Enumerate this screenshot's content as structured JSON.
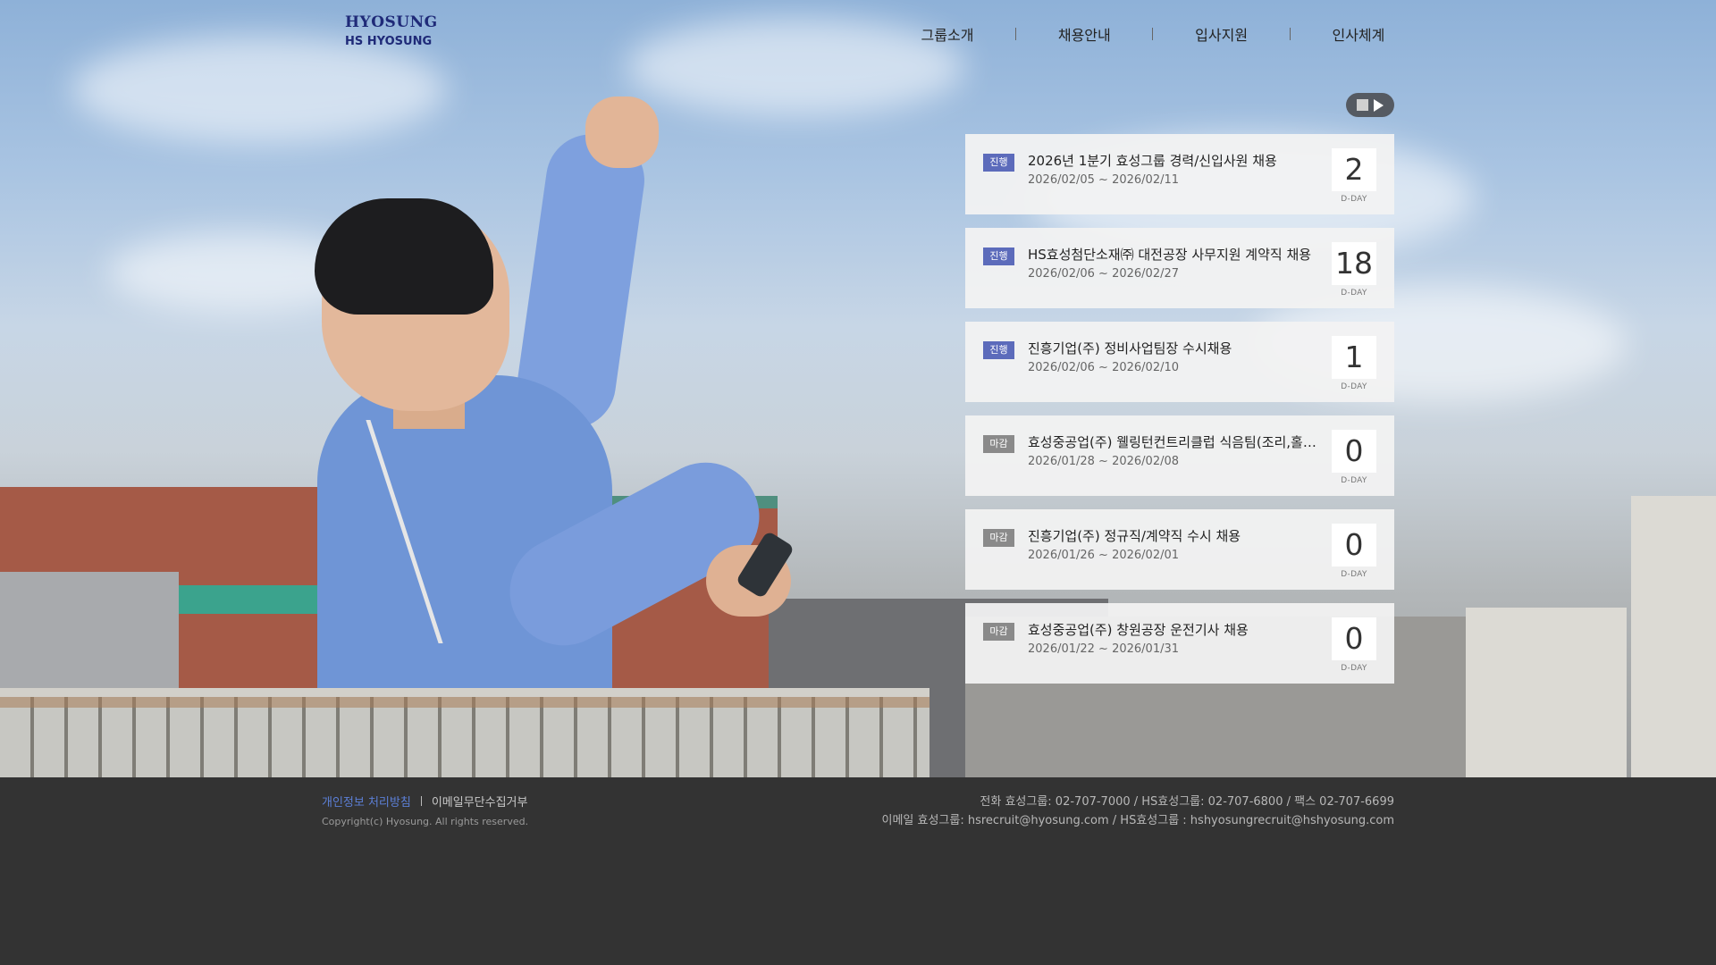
{
  "header": {
    "logo_top": "HYOSUNG",
    "logo_bottom": "HS HYOSUNG",
    "nav": [
      "그룹소개",
      "채용안내",
      "입사지원",
      "인사체계"
    ]
  },
  "slider": {
    "stop_icon": "stop-icon",
    "play_icon": "play-icon"
  },
  "jobs": [
    {
      "status": "진행",
      "title": "2026년 1분기 효성그룹 경력/신입사원 채용",
      "period": "2026/02/05 ~ 2026/02/11",
      "dday": "2",
      "dday_label": "D-DAY"
    },
    {
      "status": "진행",
      "title": "HS효성첨단소재㈜ 대전공장 사무지원 계약직 채용",
      "period": "2026/02/06 ~ 2026/02/27",
      "dday": "18",
      "dday_label": "D-DAY"
    },
    {
      "status": "진행",
      "title": "진흥기업(주) 정비사업팀장 수시채용",
      "period": "2026/02/06 ~ 2026/02/10",
      "dday": "1",
      "dday_label": "D-DAY"
    },
    {
      "status": "마감",
      "title": "효성중공업(주) 웰링턴컨트리클럽 식음팀(조리,홀…",
      "period": "2026/01/28 ~ 2026/02/08",
      "dday": "0",
      "dday_label": "D-DAY"
    },
    {
      "status": "마감",
      "title": "진흥기업(주) 정규직/계약직 수시 채용",
      "period": "2026/01/26 ~ 2026/02/01",
      "dday": "0",
      "dday_label": "D-DAY"
    },
    {
      "status": "마감",
      "title": "효성중공업(주) 창원공장 운전기사 채용",
      "period": "2026/01/22 ~ 2026/01/31",
      "dday": "0",
      "dday_label": "D-DAY"
    }
  ],
  "footer": {
    "privacy": "개인정보 처리방침",
    "email_refusal": "이메일무단수집거부",
    "copyright": "Copyright(c) Hyosung. All rights reserved.",
    "phone_line": "전화 효성그룹: 02-707-7000  / HS효성그룹: 02-707-6800  / 팩스 02-707-6699",
    "email_line": "이메일 효성그룹: hsrecruit@hyosung.com / HS효성그룹 : hshyosungrecruit@hshyosung.com"
  },
  "colors": {
    "active_badge": "#5c6bbb",
    "closed_badge": "#8a8a8a",
    "footer_bg": "#333333",
    "privacy_link": "#5c7fd6"
  }
}
